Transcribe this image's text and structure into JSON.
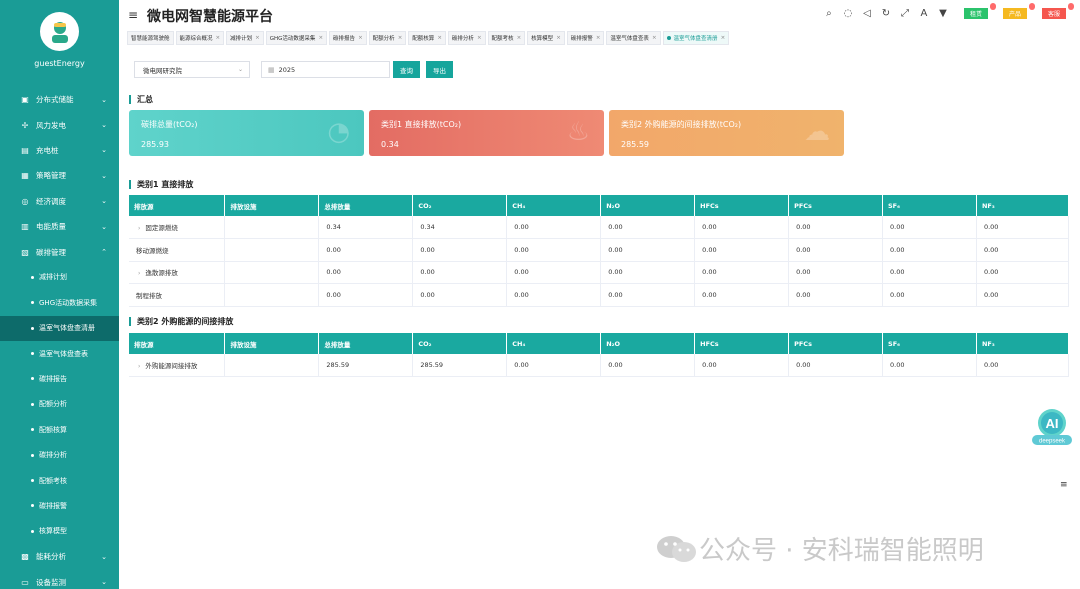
{
  "user": {
    "name": "guestEnergy"
  },
  "app": {
    "title": "微电网智慧能源平台"
  },
  "header": {
    "icons": [
      "search-icon",
      "wechat-icon",
      "volume-icon",
      "refresh-icon",
      "fullscreen-icon",
      "font-size-icon",
      "skin-icon"
    ],
    "badges": [
      {
        "label": "租赁",
        "color": "#2bc36c",
        "count": ""
      },
      {
        "label": "产品",
        "color": "#f5b920",
        "count": ""
      },
      {
        "label": "客服",
        "color": "#f5564e",
        "count": ""
      }
    ]
  },
  "sidebar": {
    "items": [
      {
        "label": "分布式储能",
        "icon": "battery-icon"
      },
      {
        "label": "风力发电",
        "icon": "wind-icon"
      },
      {
        "label": "充电桩",
        "icon": "charger-icon"
      },
      {
        "label": "策略管理",
        "icon": "strategy-icon"
      },
      {
        "label": "经济调度",
        "icon": "dispatch-icon"
      },
      {
        "label": "电能质量",
        "icon": "power-quality-icon"
      },
      {
        "label": "碳排管理",
        "icon": "carbon-icon",
        "expanded": true
      }
    ],
    "sub_items": [
      {
        "label": "减排计划"
      },
      {
        "label": "GHG活动数据采集"
      },
      {
        "label": "温室气体盘查清册",
        "active": true
      },
      {
        "label": "温室气体盘查表"
      },
      {
        "label": "碳排报告"
      },
      {
        "label": "配额分析"
      },
      {
        "label": "配额核算"
      },
      {
        "label": "碳排分析"
      },
      {
        "label": "配额考核"
      },
      {
        "label": "碳排报警"
      },
      {
        "label": "核算模型"
      }
    ],
    "bottom_items": [
      {
        "label": "能耗分析",
        "icon": "energy-icon"
      },
      {
        "label": "设备监测",
        "icon": "monitor-icon"
      }
    ]
  },
  "tabs": [
    {
      "label": "智慧能源驾驶舱"
    },
    {
      "label": "能源综合概况"
    },
    {
      "label": "减排计划"
    },
    {
      "label": "GHG活动数据采集"
    },
    {
      "label": "碳排报告"
    },
    {
      "label": "配额分析"
    },
    {
      "label": "配额核算"
    },
    {
      "label": "碳排分析"
    },
    {
      "label": "配额考核"
    },
    {
      "label": "核算模型"
    },
    {
      "label": "碳排报警"
    },
    {
      "label": "温室气体盘查表"
    },
    {
      "label": "温室气体盘查清册",
      "active": true
    }
  ],
  "filter": {
    "org": "微电网研究院",
    "year": "2025",
    "query_label": "查询",
    "export_label": "导出"
  },
  "summary": {
    "section_title": "汇总",
    "cards": [
      {
        "title": "碳排总量(tCO₂)",
        "value": "285.93",
        "color_from": "#5fd3cb",
        "color_to": "#4cc7bf"
      },
      {
        "title": "类别1 直接排放(tCO₂)",
        "value": "0.34",
        "color_from": "#e36c63",
        "color_to": "#ef8a74"
      },
      {
        "title": "类别2 外购能源的间接排放(tCO₂)",
        "value": "285.59",
        "color_from": "#f2a76a",
        "color_to": "#f0b36c"
      }
    ]
  },
  "table1": {
    "section_title": "类别1 直接排放",
    "headers": [
      "排放源",
      "排放设施",
      "总排放量",
      "CO₂",
      "CH₄",
      "N₂O",
      "HFCs",
      "PFCs",
      "SF₆",
      "NF₃"
    ],
    "rows": [
      [
        "固定源燃烧",
        "",
        "0.34",
        "0.34",
        "0.00",
        "0.00",
        "0.00",
        "0.00",
        "0.00",
        "0.00"
      ],
      [
        "移动源燃烧",
        "",
        "0.00",
        "0.00",
        "0.00",
        "0.00",
        "0.00",
        "0.00",
        "0.00",
        "0.00"
      ],
      [
        "逸散源排放",
        "",
        "0.00",
        "0.00",
        "0.00",
        "0.00",
        "0.00",
        "0.00",
        "0.00",
        "0.00"
      ],
      [
        "制程排放",
        "",
        "0.00",
        "0.00",
        "0.00",
        "0.00",
        "0.00",
        "0.00",
        "0.00",
        "0.00"
      ]
    ]
  },
  "table2": {
    "section_title": "类别2 外购能源的间接排放",
    "headers": [
      "排放源",
      "排放设施",
      "总排放量",
      "CO₂",
      "CH₄",
      "N₂O",
      "HFCs",
      "PFCs",
      "SF₆",
      "NF₃"
    ],
    "rows": [
      [
        "外购能源间接排放",
        "",
        "285.59",
        "285.59",
        "0.00",
        "0.00",
        "0.00",
        "0.00",
        "0.00",
        "0.00"
      ]
    ]
  },
  "ai": {
    "label": "AI",
    "sub": "deepseek"
  },
  "watermark": {
    "text": "公众号 · 安科瑞智能照明"
  }
}
